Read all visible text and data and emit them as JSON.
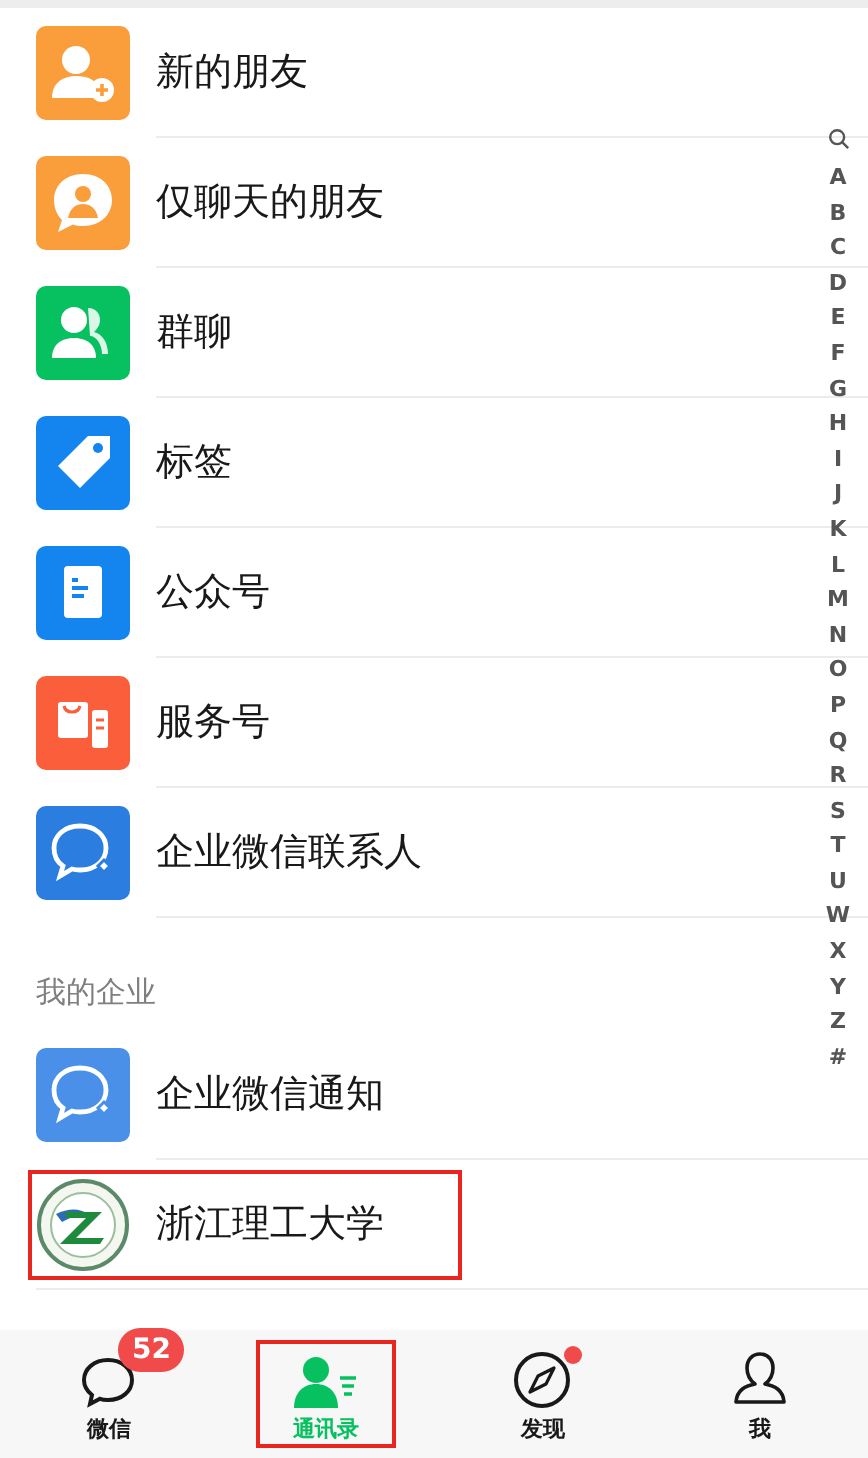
{
  "contacts": [
    {
      "kind": "new-friend",
      "label": "新的朋友",
      "highlighted": false
    },
    {
      "kind": "chat-only",
      "label": "仅聊天的朋友",
      "highlighted": false
    },
    {
      "kind": "group",
      "label": "群聊",
      "highlighted": false
    },
    {
      "kind": "tag",
      "label": "标签",
      "highlighted": false
    },
    {
      "kind": "official",
      "label": "公众号",
      "highlighted": false
    },
    {
      "kind": "service",
      "label": "服务号",
      "highlighted": false
    },
    {
      "kind": "wecom",
      "label": "企业微信联系人",
      "highlighted": false
    }
  ],
  "section": {
    "title": "我的企业",
    "items": [
      {
        "kind": "wecom-notice",
        "label": "企业微信通知",
        "highlighted": false
      },
      {
        "kind": "emblem",
        "label": "浙江理工大学",
        "highlighted": true
      }
    ]
  },
  "index": [
    "A",
    "B",
    "C",
    "D",
    "E",
    "F",
    "G",
    "H",
    "I",
    "J",
    "K",
    "L",
    "M",
    "N",
    "O",
    "P",
    "Q",
    "R",
    "S",
    "T",
    "U",
    "W",
    "X",
    "Y",
    "Z",
    "#"
  ],
  "tabs": [
    {
      "kind": "chats",
      "label": "微信",
      "selected": false,
      "badge": "52",
      "highlighted": false
    },
    {
      "kind": "contacts",
      "label": "通讯录",
      "selected": true,
      "highlighted": true
    },
    {
      "kind": "discover",
      "label": "发现",
      "selected": false,
      "dot": true,
      "highlighted": false
    },
    {
      "kind": "me",
      "label": "我",
      "selected": false,
      "highlighted": false
    }
  ]
}
